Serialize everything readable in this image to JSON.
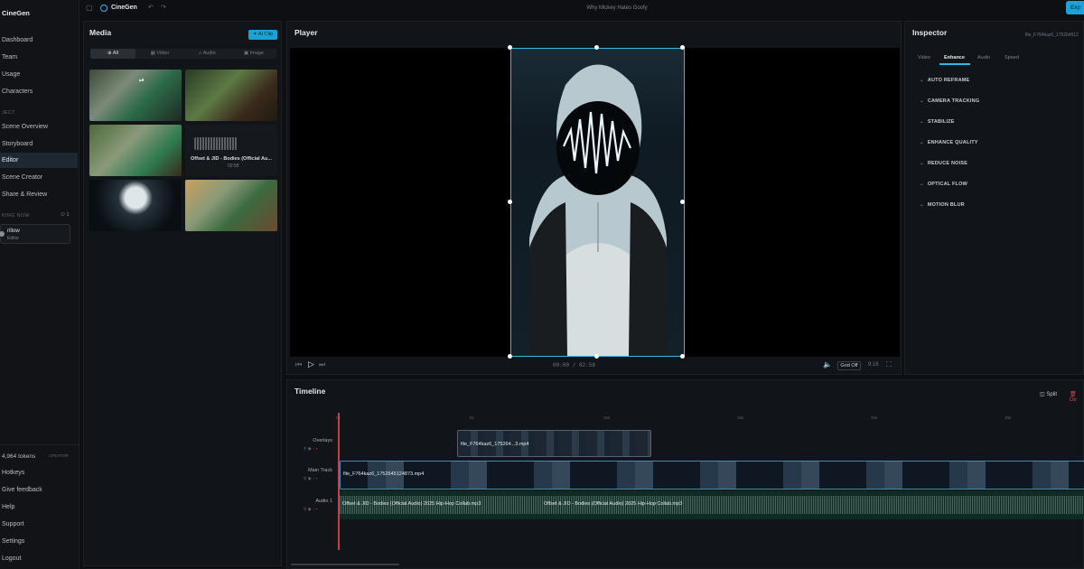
{
  "app": {
    "brand": "CineGen",
    "name": "CineGen",
    "project_title": "Why Mickey Hates Goofy",
    "export_label": "Exp"
  },
  "sidebar": {
    "items": [
      {
        "label": "Dashboard"
      },
      {
        "label": "Team"
      },
      {
        "label": "Usage"
      },
      {
        "label": "Characters"
      },
      {
        "label": "Scene Overview"
      },
      {
        "label": "Storyboard"
      },
      {
        "label": "Editor"
      },
      {
        "label": "Scene Creator"
      },
      {
        "label": "Share & Review"
      }
    ],
    "project_section": "JECT",
    "working_now_label": "KING NOW",
    "working_count": "1",
    "presence": {
      "name": "rillow",
      "role": "Editor"
    },
    "tokens": "4,964 tokens",
    "plan": "CREATOR",
    "bottom_items": [
      {
        "label": "Hotkeys"
      },
      {
        "label": "Give feedback"
      },
      {
        "label": "Help"
      },
      {
        "label": "Support"
      },
      {
        "label": "Settings"
      },
      {
        "label": "Logout"
      }
    ]
  },
  "media": {
    "title": "Media",
    "ai_button": "AI Clip",
    "filters": [
      {
        "label": "All"
      },
      {
        "label": "Video"
      },
      {
        "label": "Audio"
      },
      {
        "label": "Image"
      }
    ],
    "audio_item": {
      "name": "Offset & JID - Bodies (Official Au...",
      "duration": "02:58"
    }
  },
  "player": {
    "title": "Player",
    "time_current": "00:00",
    "time_sep": "/",
    "time_total": "02:58",
    "grid_label": "Grid Off",
    "aspect": "9:16"
  },
  "inspector": {
    "title": "Inspector",
    "file_name": "file_F764kaz6_175264512",
    "tabs": [
      {
        "label": "Video"
      },
      {
        "label": "Enhance"
      },
      {
        "label": "Audio"
      },
      {
        "label": "Speed"
      }
    ],
    "items": [
      {
        "label": "AUTO REFRAME"
      },
      {
        "label": "CAMERA TRACKING"
      },
      {
        "label": "STABILIZE"
      },
      {
        "label": "ENHANCE QUALITY"
      },
      {
        "label": "REDUCE NOISE"
      },
      {
        "label": "OPTICAL FLOW"
      },
      {
        "label": "MOTION BLUR"
      }
    ]
  },
  "timeline": {
    "title": "Timeline",
    "split_label": "Split",
    "delete_label": "De",
    "ruler": [
      "0s",
      "5s",
      "10s",
      "15s",
      "20s",
      "25s"
    ],
    "tracks": [
      {
        "label": "Overlays"
      },
      {
        "label": "Main Track"
      },
      {
        "label": "Audio 1"
      }
    ],
    "overlay_clip": "file_F764kaz6_175264...3.mp4",
    "main_clip": "file_F764kaz6_1752645124873.mp4",
    "audio_clip_1": "Offset & JID - Bodies (Official Audio) 2025 Hip-Hop Collab.mp3",
    "audio_clip_2": "Offset & JID - Bodies (Official Audio) 2025 Hip-Hop Collab.mp3"
  }
}
